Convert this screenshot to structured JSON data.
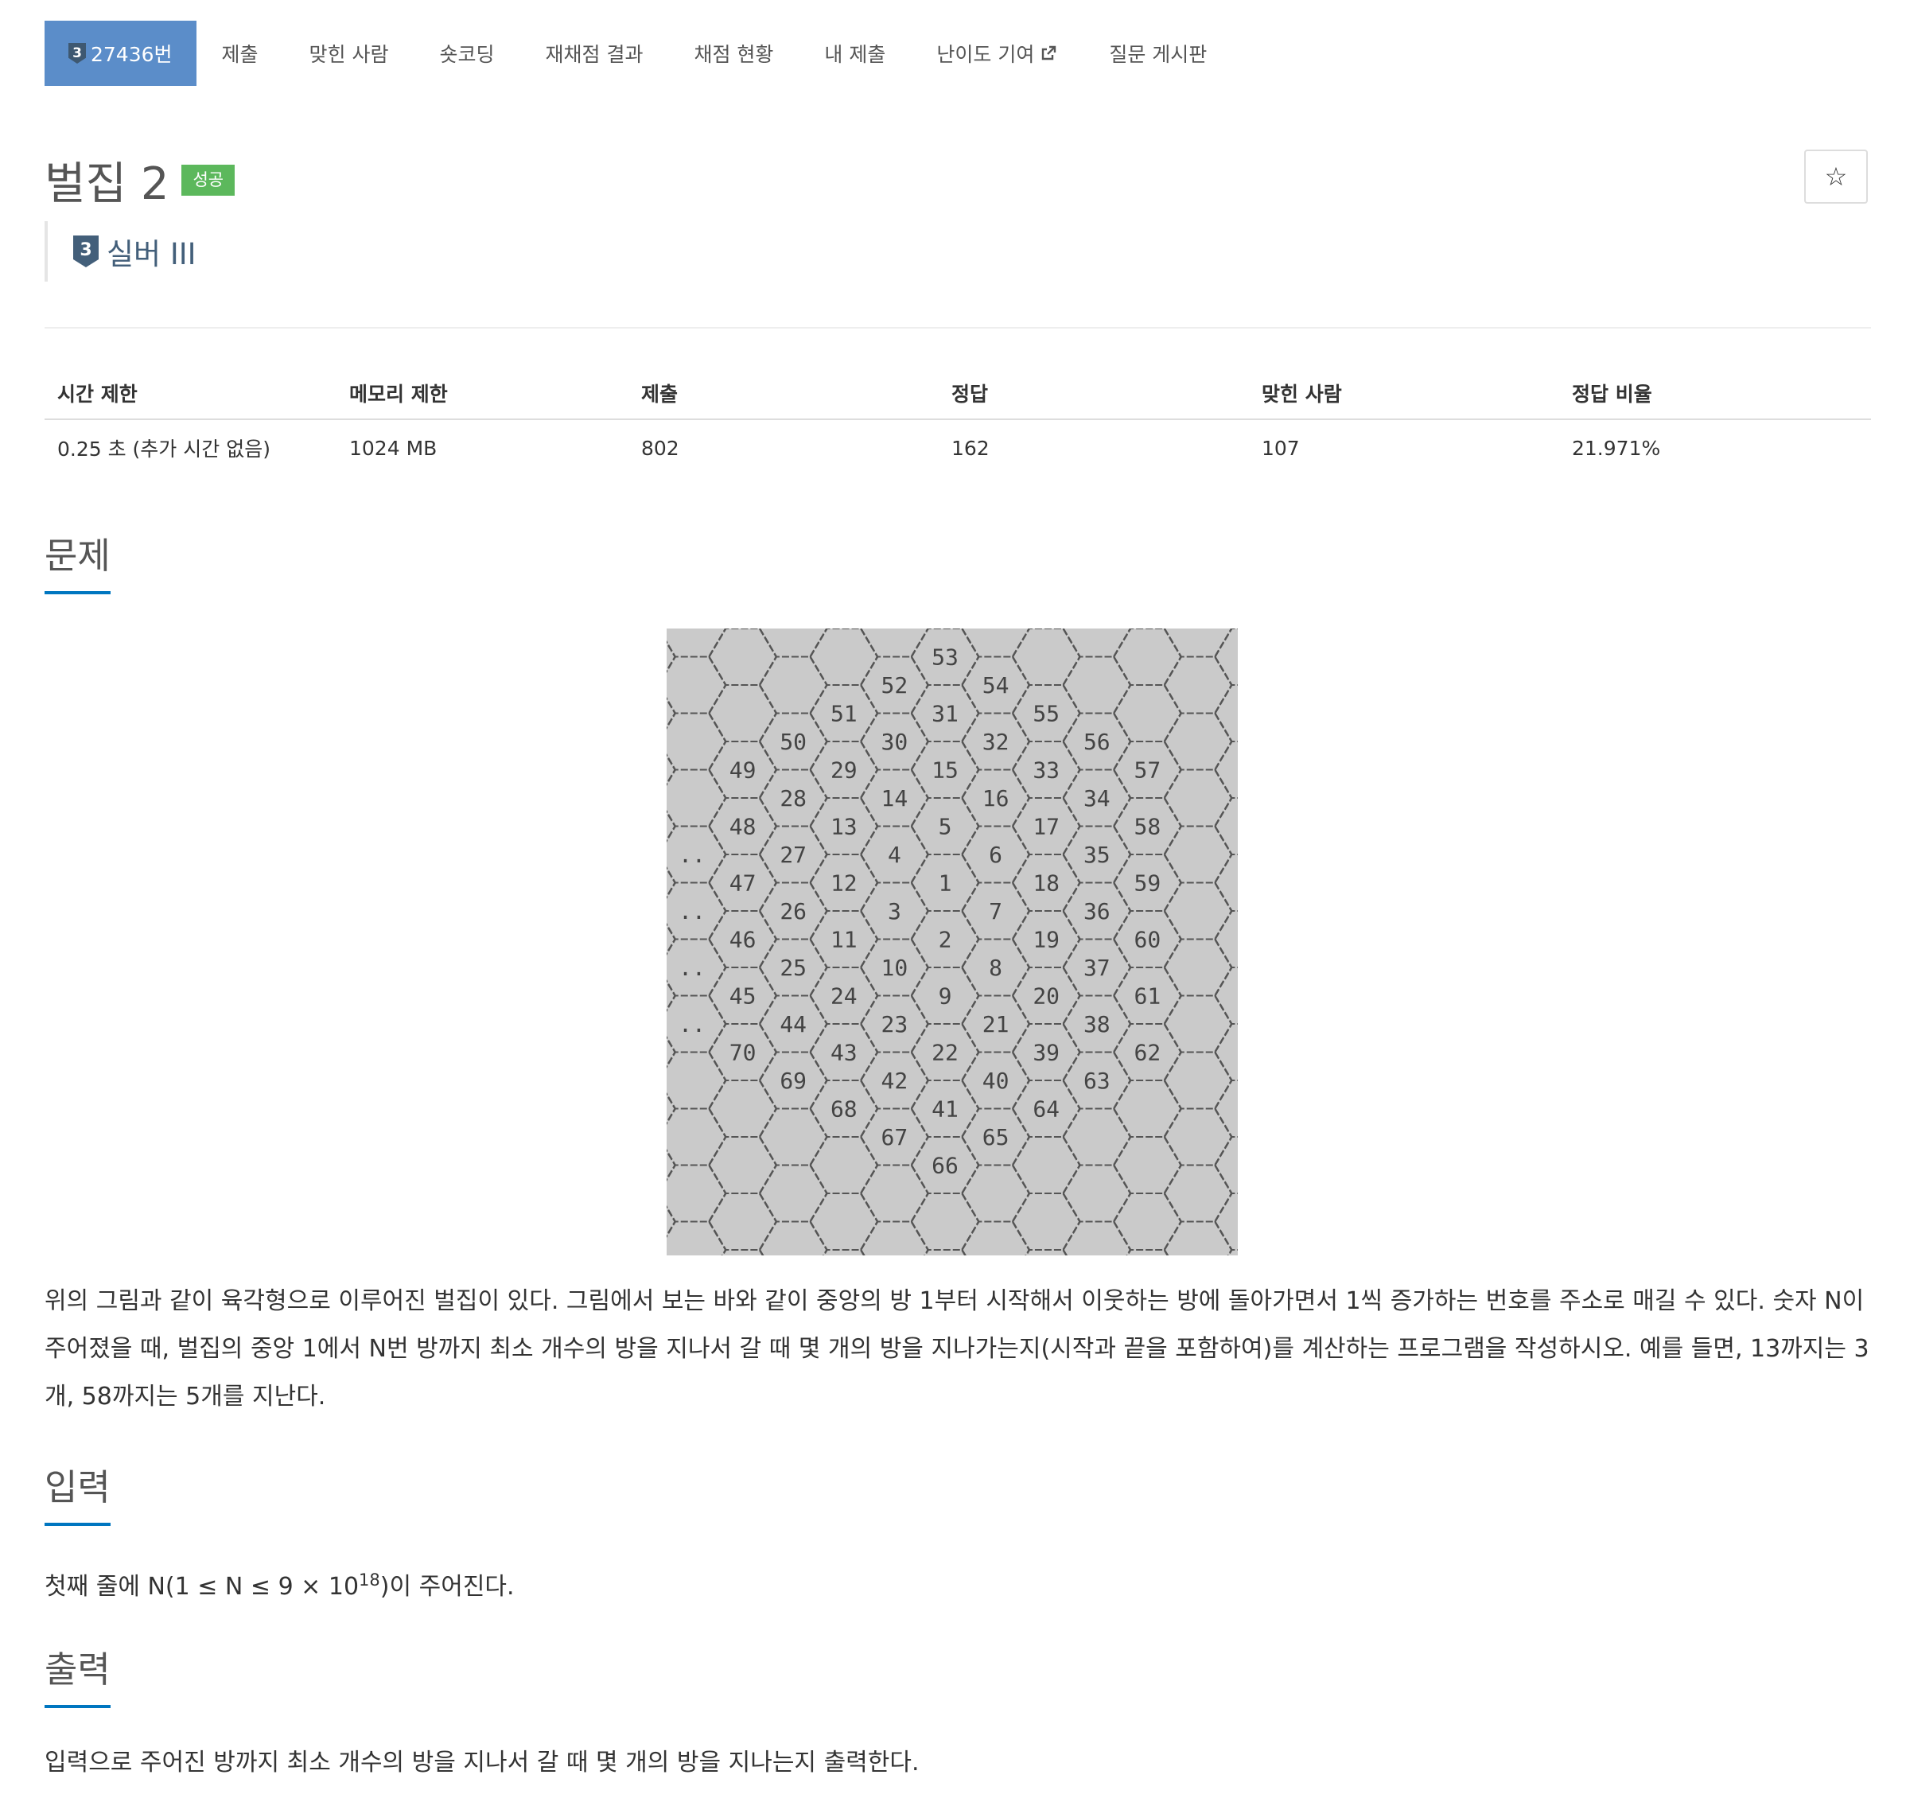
{
  "nav": {
    "problem_tab": "27436번",
    "problem_tier_digit": "3",
    "tabs": [
      "제출",
      "맞힌 사람",
      "숏코딩",
      "재채점 결과",
      "채점 현황",
      "내 제출",
      "난이도 기여",
      "질문 게시판"
    ]
  },
  "problem": {
    "title": "벌집 2",
    "status_badge": "성공",
    "tier_digit": "3",
    "tier_name": "실버 III",
    "star_label": "☆"
  },
  "info_table": {
    "headers": [
      "시간 제한",
      "메모리 제한",
      "제출",
      "정답",
      "맞힌 사람",
      "정답 비율"
    ],
    "values": [
      "0.25 초 (추가 시간 없음)",
      "1024 MB",
      "802",
      "162",
      "107",
      "21.971%"
    ]
  },
  "sections": {
    "problem_title": "문제",
    "problem_text": "위의 그림과 같이 육각형으로 이루어진 벌집이 있다. 그림에서 보는 바와 같이 중앙의 방 1부터 시작해서 이웃하는 방에 돌아가면서 1씩 증가하는 번호를 주소로 매길 수 있다. 숫자 N이 주어졌을 때, 벌집의 중앙 1에서 N번 방까지 최소 개수의 방을 지나서 갈 때 몇 개의 방을 지나가는지(시작과 끝을 포함하여)를 계산하는 프로그램을 작성하시오. 예를 들면, 13까지는 3개, 58까지는 5개를 지난다.",
    "input_title": "입력",
    "input_text_before": "첫째 줄에 N(1 ≤ N ≤ 9 × 10",
    "input_text_sup": "18",
    "input_text_after": ")이 주어진다.",
    "output_title": "출력",
    "output_text": "입력으로 주어진 방까지 최소 개수의 방을 지나서 갈 때 몇 개의 방을 지나는지 출력한다."
  },
  "figure": {
    "cell_labels": [
      {
        "t": "53",
        "c": 5,
        "r": 1
      },
      {
        "t": "52",
        "c": 4,
        "r": 2
      },
      {
        "t": "54",
        "c": 6,
        "r": 2
      },
      {
        "t": "51",
        "c": 3,
        "r": 3
      },
      {
        "t": "31",
        "c": 5,
        "r": 3
      },
      {
        "t": "55",
        "c": 7,
        "r": 3
      },
      {
        "t": "50",
        "c": 2,
        "r": 4
      },
      {
        "t": "30",
        "c": 4,
        "r": 4
      },
      {
        "t": "32",
        "c": 6,
        "r": 4
      },
      {
        "t": "56",
        "c": 8,
        "r": 4
      },
      {
        "t": "49",
        "c": 1,
        "r": 5
      },
      {
        "t": "29",
        "c": 3,
        "r": 5
      },
      {
        "t": "15",
        "c": 5,
        "r": 5
      },
      {
        "t": "33",
        "c": 7,
        "r": 5
      },
      {
        "t": "57",
        "c": 9,
        "r": 5
      },
      {
        "t": "28",
        "c": 2,
        "r": 6
      },
      {
        "t": "14",
        "c": 4,
        "r": 6
      },
      {
        "t": "16",
        "c": 6,
        "r": 6
      },
      {
        "t": "34",
        "c": 8,
        "r": 6
      },
      {
        "t": "48",
        "c": 1,
        "r": 7
      },
      {
        "t": "13",
        "c": 3,
        "r": 7
      },
      {
        "t": "5",
        "c": 5,
        "r": 7
      },
      {
        "t": "17",
        "c": 7,
        "r": 7
      },
      {
        "t": "58",
        "c": 9,
        "r": 7
      },
      {
        "t": "..",
        "c": 0,
        "r": 8
      },
      {
        "t": "27",
        "c": 2,
        "r": 8
      },
      {
        "t": "4",
        "c": 4,
        "r": 8
      },
      {
        "t": "6",
        "c": 6,
        "r": 8
      },
      {
        "t": "35",
        "c": 8,
        "r": 8
      },
      {
        "t": "47",
        "c": 1,
        "r": 9
      },
      {
        "t": "12",
        "c": 3,
        "r": 9
      },
      {
        "t": "1",
        "c": 5,
        "r": 9
      },
      {
        "t": "18",
        "c": 7,
        "r": 9
      },
      {
        "t": "59",
        "c": 9,
        "r": 9
      },
      {
        "t": "..",
        "c": 0,
        "r": 10
      },
      {
        "t": "26",
        "c": 2,
        "r": 10
      },
      {
        "t": "3",
        "c": 4,
        "r": 10
      },
      {
        "t": "7",
        "c": 6,
        "r": 10
      },
      {
        "t": "36",
        "c": 8,
        "r": 10
      },
      {
        "t": "46",
        "c": 1,
        "r": 11
      },
      {
        "t": "11",
        "c": 3,
        "r": 11
      },
      {
        "t": "2",
        "c": 5,
        "r": 11
      },
      {
        "t": "19",
        "c": 7,
        "r": 11
      },
      {
        "t": "60",
        "c": 9,
        "r": 11
      },
      {
        "t": "..",
        "c": 0,
        "r": 12
      },
      {
        "t": "25",
        "c": 2,
        "r": 12
      },
      {
        "t": "10",
        "c": 4,
        "r": 12
      },
      {
        "t": "8",
        "c": 6,
        "r": 12
      },
      {
        "t": "37",
        "c": 8,
        "r": 12
      },
      {
        "t": "45",
        "c": 1,
        "r": 13
      },
      {
        "t": "24",
        "c": 3,
        "r": 13
      },
      {
        "t": "9",
        "c": 5,
        "r": 13
      },
      {
        "t": "20",
        "c": 7,
        "r": 13
      },
      {
        "t": "61",
        "c": 9,
        "r": 13
      },
      {
        "t": "..",
        "c": 0,
        "r": 14
      },
      {
        "t": "44",
        "c": 2,
        "r": 14
      },
      {
        "t": "23",
        "c": 4,
        "r": 14
      },
      {
        "t": "21",
        "c": 6,
        "r": 14
      },
      {
        "t": "38",
        "c": 8,
        "r": 14
      },
      {
        "t": "70",
        "c": 1,
        "r": 15
      },
      {
        "t": "43",
        "c": 3,
        "r": 15
      },
      {
        "t": "22",
        "c": 5,
        "r": 15
      },
      {
        "t": "39",
        "c": 7,
        "r": 15
      },
      {
        "t": "62",
        "c": 9,
        "r": 15
      },
      {
        "t": "69",
        "c": 2,
        "r": 16
      },
      {
        "t": "42",
        "c": 4,
        "r": 16
      },
      {
        "t": "40",
        "c": 6,
        "r": 16
      },
      {
        "t": "63",
        "c": 8,
        "r": 16
      },
      {
        "t": "68",
        "c": 3,
        "r": 17
      },
      {
        "t": "41",
        "c": 5,
        "r": 17
      },
      {
        "t": "64",
        "c": 7,
        "r": 17
      },
      {
        "t": "67",
        "c": 4,
        "r": 18
      },
      {
        "t": "65",
        "c": 6,
        "r": 18
      },
      {
        "t": "66",
        "c": 5,
        "r": 19
      }
    ]
  },
  "colors": {
    "tab_active": "#5b8dc9",
    "tier_silver": "#435f7a",
    "success_badge": "#5cb85c",
    "section_underline": "#0076c0",
    "figure_background": "#cacaca"
  }
}
